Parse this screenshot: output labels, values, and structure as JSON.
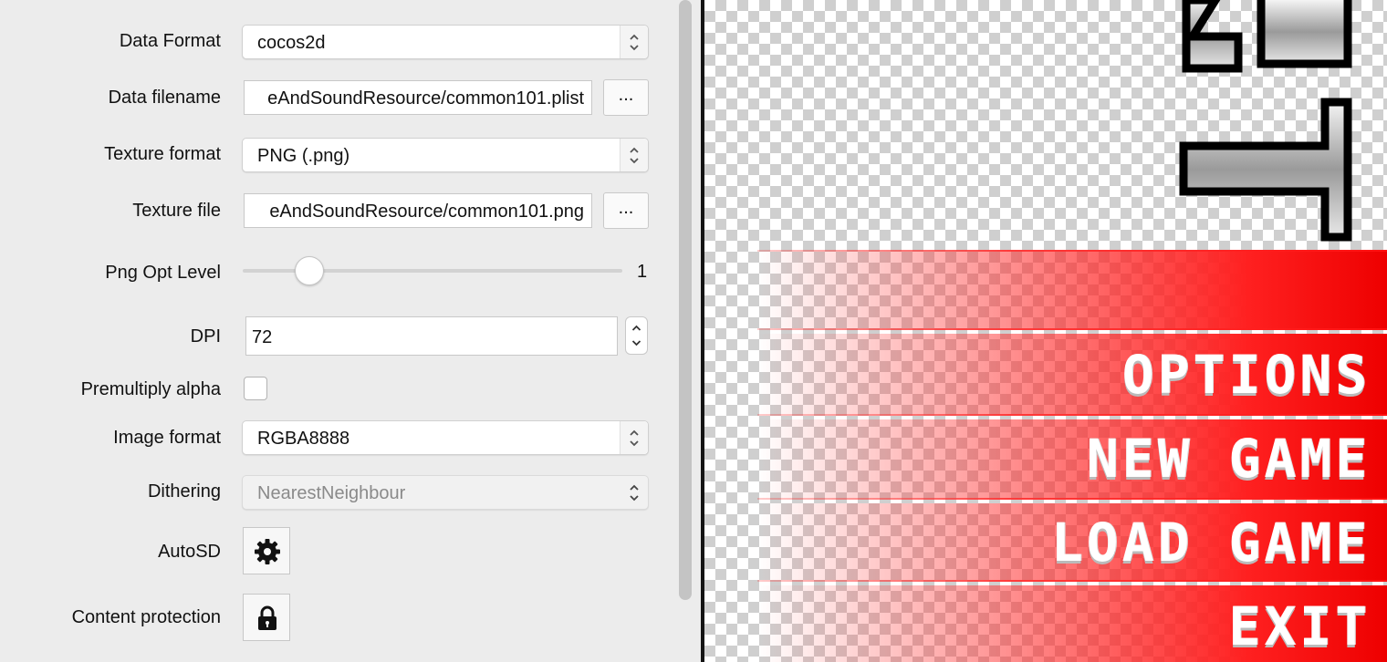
{
  "settings": {
    "data_format": {
      "label": "Data Format",
      "value": "cocos2d"
    },
    "data_filename": {
      "label": "Data filename",
      "value": "eAndSoundResource/common101.plist",
      "browse": "..."
    },
    "texture_format": {
      "label": "Texture format",
      "value": "PNG (.png)"
    },
    "texture_file": {
      "label": "Texture file",
      "value": "eAndSoundResource/common101.png",
      "browse": "..."
    },
    "png_opt_level": {
      "label": "Png Opt Level",
      "value": "1",
      "min": 0,
      "max": 7
    },
    "dpi": {
      "label": "DPI",
      "value": "72"
    },
    "premultiply_alpha": {
      "label": "Premultiply alpha",
      "checked": false
    },
    "image_format": {
      "label": "Image format",
      "value": "RGBA8888"
    },
    "dithering": {
      "label": "Dithering",
      "value": "NearestNeighbour",
      "disabled": true
    },
    "autosd": {
      "label": "AutoSD",
      "icon": "gear-icon"
    },
    "content_protection": {
      "label": "Content protection",
      "icon": "lock-icon"
    }
  },
  "preview": {
    "menu_items": [
      "OPTIONS",
      "NEW GAME",
      "LOAD GAME",
      "EXIT"
    ],
    "colors": {
      "band_red": "#ee0000",
      "checker": "#cfcfcf"
    }
  }
}
